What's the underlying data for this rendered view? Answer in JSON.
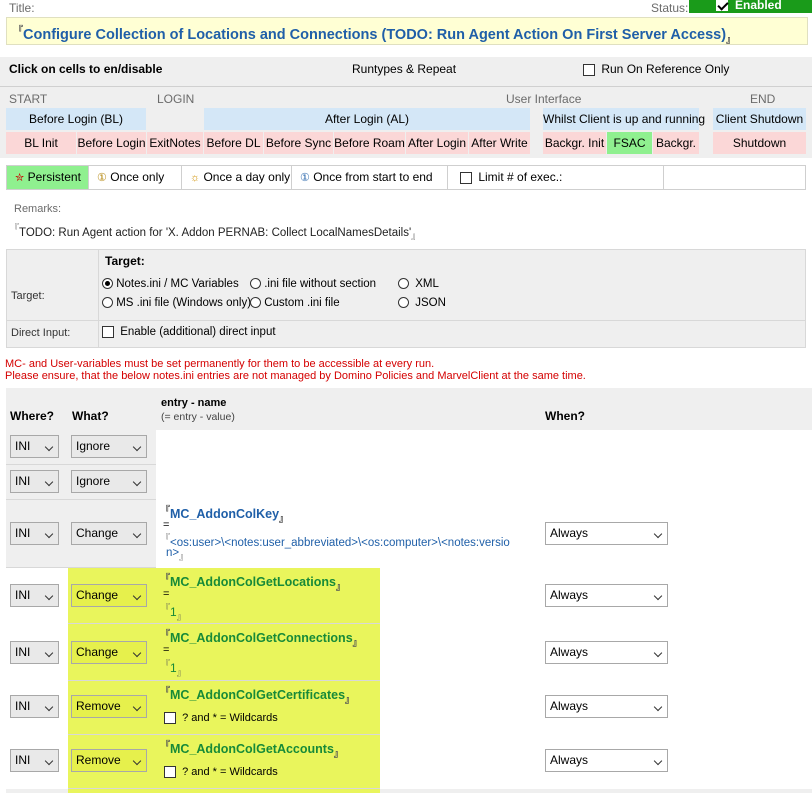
{
  "header": {
    "title_label": "Title:",
    "status_label": "Status:",
    "enabled_label": "Enabled",
    "title_text": "Configure Collection of Locations and Connections (TODO: Run Agent Action On First Server Access)"
  },
  "runtypes": {
    "click_hint": "Click on cells to en/disable",
    "runtypes_label": "Runtypes & Repeat",
    "run_on_reference_label": "Run On Reference Only",
    "start_label": "START",
    "login_label": "LOGIN",
    "ui_label": "User Interface",
    "end_label": "END",
    "before_login": "Before Login (BL)",
    "after_login": "After Login (AL)",
    "whilst_client": "Whilst Client is up and running",
    "client_shutdown": "Client Shutdown",
    "cells": [
      "BL Init",
      "Before Login",
      "ExitNotes",
      "Before DL",
      "Before Sync",
      "Before Roam",
      "After Login",
      "After Write",
      "Backgr. Init",
      "FSAC",
      "Backgr.",
      "Shutdown"
    ]
  },
  "frequency": {
    "persistent": "Persistent",
    "once_only": "Once only",
    "once_a_day": "Once a day only",
    "once_start_end": "Once from start to end",
    "limit_exec": "Limit # of exec.:"
  },
  "remarks": {
    "label": "Remarks:",
    "text": "TODO: Run Agent action for 'X. Addon PERNAB: Collect LocalNamesDetails'"
  },
  "target": {
    "section_label": "Target:",
    "row_label": "Target:",
    "options": [
      "Notes.ini / MC Variables",
      ".ini file without section",
      "XML",
      "MS .ini file (Windows only)",
      "Custom .ini file",
      "JSON"
    ],
    "selected": "Notes.ini / MC Variables",
    "direct_input_label": "Direct Input:",
    "direct_input_option": "Enable (additional) direct input"
  },
  "warnings": [
    "MC- and User-variables must be set permanently for them to be accessible at every run.",
    "Please ensure, that the below notes.ini entries are not managed by Domino Policies and MarvelClient at the same time."
  ],
  "grid": {
    "col_where": "Where?",
    "col_what": "What?",
    "col_entry": "entry - name",
    "col_entry_sub": "(= entry - value)",
    "col_when": "When?",
    "equals": "=",
    "wildcards": "? and * = Wildcards",
    "rows": [
      {
        "where": "INI",
        "what": "Ignore"
      },
      {
        "where": "INI",
        "what": "Ignore"
      },
      {
        "where": "INI",
        "what": "Change",
        "name": "MC_AddonColKey",
        "value_line1": "<os:user>\\<notes:user_abbreviated>\\<os:computer>\\<notes:versio",
        "value_line2": "n>",
        "when": "Always"
      },
      {
        "where": "INI",
        "what": "Change",
        "name": "MC_AddonColGetLocations",
        "value": "1",
        "when": "Always"
      },
      {
        "where": "INI",
        "what": "Change",
        "name": "MC_AddonColGetConnections",
        "value": "1",
        "when": "Always"
      },
      {
        "where": "INI",
        "what": "Remove",
        "name": "MC_AddonColGetCertificates",
        "when": "Always"
      },
      {
        "where": "INI",
        "what": "Remove",
        "name": "MC_AddonColGetAccounts",
        "when": "Always"
      }
    ]
  },
  "colors": {
    "accent_blue": "#1f5fa8",
    "enabled_green": "#1a9b1a",
    "highlight_yellow": "#e9f55c",
    "entry_green": "#178a38",
    "warning_red": "#d40000"
  }
}
